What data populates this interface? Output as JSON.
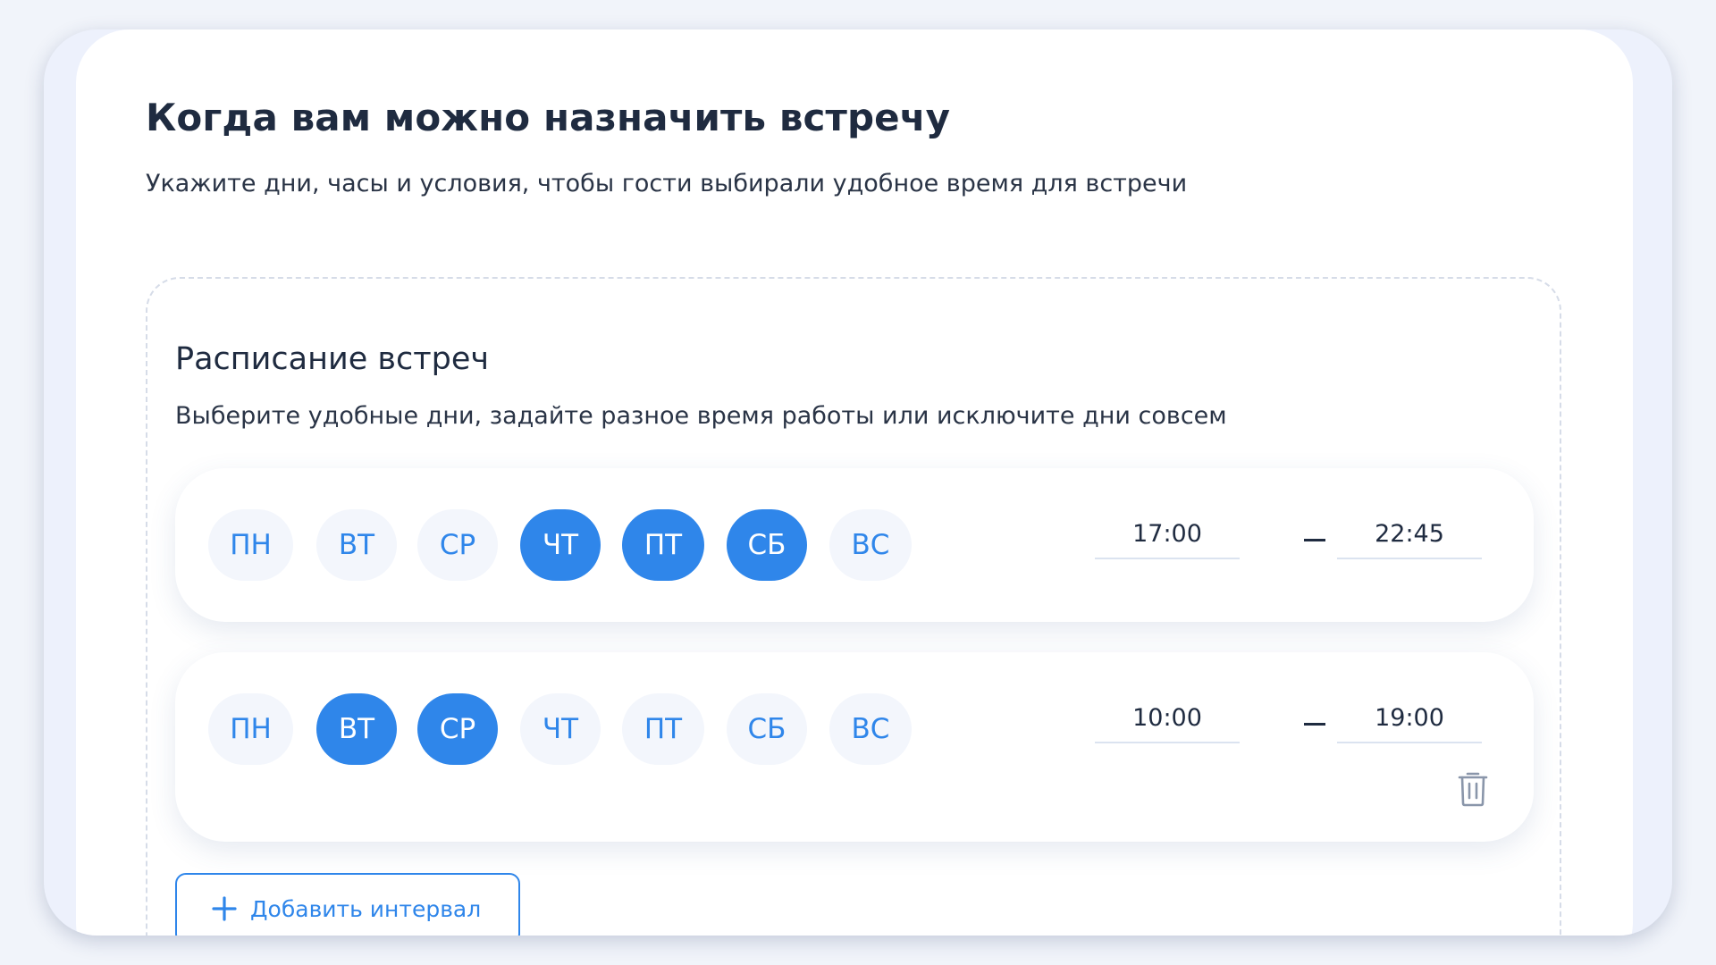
{
  "page": {
    "title": "Когда вам можно назначить встречу",
    "subtitle": "Укажите дни, часы и условия, чтобы гости выбирали удобное время для встречи"
  },
  "schedule": {
    "title": "Расписание встреч",
    "subtitle": "Выберите удобные дни, задайте разное время работы или исключите дни совсем",
    "intervals": [
      {
        "days": [
          {
            "label": "ПН",
            "selected": false
          },
          {
            "label": "ВТ",
            "selected": false
          },
          {
            "label": "СР",
            "selected": false
          },
          {
            "label": "ЧТ",
            "selected": true
          },
          {
            "label": "ПТ",
            "selected": true
          },
          {
            "label": "СБ",
            "selected": true
          },
          {
            "label": "ВС",
            "selected": false
          }
        ],
        "from": "17:00",
        "to": "22:45",
        "deletable": false
      },
      {
        "days": [
          {
            "label": "ПН",
            "selected": false
          },
          {
            "label": "ВТ",
            "selected": true
          },
          {
            "label": "СР",
            "selected": true
          },
          {
            "label": "ЧТ",
            "selected": false
          },
          {
            "label": "ПТ",
            "selected": false
          },
          {
            "label": "СБ",
            "selected": false
          },
          {
            "label": "ВС",
            "selected": false
          }
        ],
        "from": "10:00",
        "to": "19:00",
        "deletable": true
      }
    ],
    "add_button": {
      "icon": "plus-icon",
      "label": "Добавить интервал"
    }
  },
  "colors": {
    "accent": "#2f86ea",
    "day_bg": "#f3f6fc",
    "text": "#1f2b40"
  }
}
